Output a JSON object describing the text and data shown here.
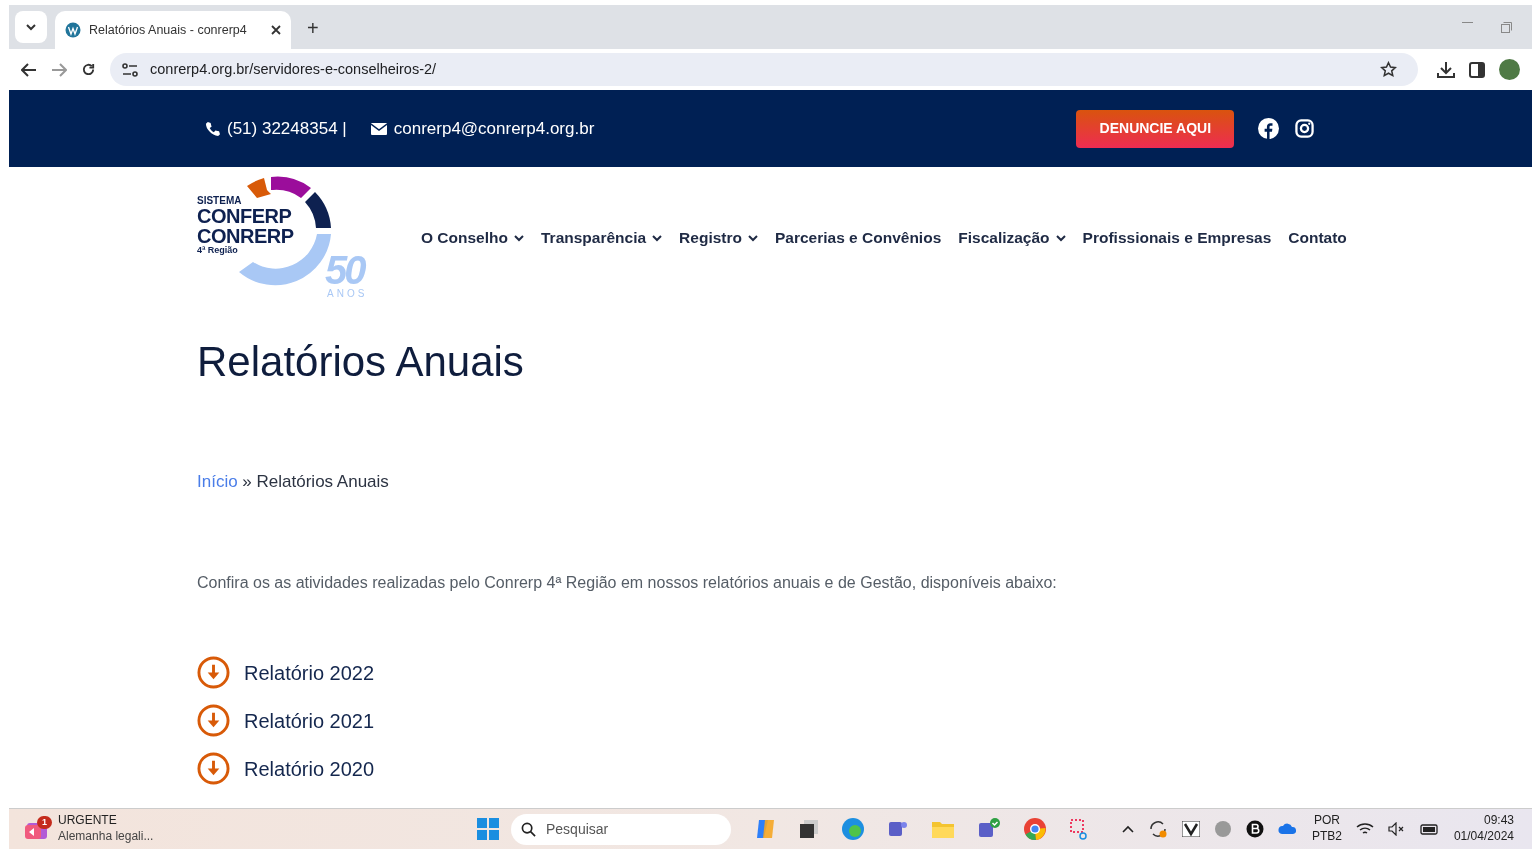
{
  "browser": {
    "tabs": [
      {
        "title": "Relatórios Anuais - conrerp4",
        "selected": true
      }
    ],
    "new_tab": "+",
    "url": "conrerp4.org.br/servidores-e-conselheiros-2/"
  },
  "topbar": {
    "phone": "(51) 32248354 |",
    "email": "conrerp4@conrerp4.org.br",
    "cta": "DENUNCIE AQUI"
  },
  "logo": {
    "kicker": "SISTEMA",
    "line_1": "CONFERP",
    "line_2": "CONRERP",
    "region": "4ª Região",
    "anniversary": "50",
    "anniversary_unit": "ANOS"
  },
  "nav": [
    {
      "label": "O Conselho",
      "kind": "dropdown"
    },
    {
      "label": "Transparência",
      "kind": "dropdown"
    },
    {
      "label": "Registro",
      "kind": "dropdown"
    },
    {
      "label": "Parcerias e Convênios",
      "kind": "link"
    },
    {
      "label": "Fiscalização",
      "kind": "dropdown"
    },
    {
      "label": "Profissionais e Empresas",
      "kind": "link"
    },
    {
      "label": "Contato",
      "kind": "link"
    }
  ],
  "page_title": "Relatórios Anuais",
  "breadcrumb": {
    "home": "Início",
    "separator": "»",
    "current": "Relatórios Anuais"
  },
  "intro": "Confira os as atividades realizadas pelo Conrerp 4ª Região em nossos relatórios anuais e de Gestão, disponíveis abaixo:",
  "reports": [
    {
      "label": "Relatório 2022"
    },
    {
      "label": "Relatório 2021"
    },
    {
      "label": "Relatório 2020"
    }
  ],
  "taskbar": {
    "news": {
      "badge": "1",
      "headline": "URGENTE",
      "summary": "Alemanha legali..."
    },
    "search_placeholder": "Pesquisar",
    "language": "POR",
    "layout": "PTB2",
    "time": "09:43",
    "date": "01/04/2024"
  }
}
